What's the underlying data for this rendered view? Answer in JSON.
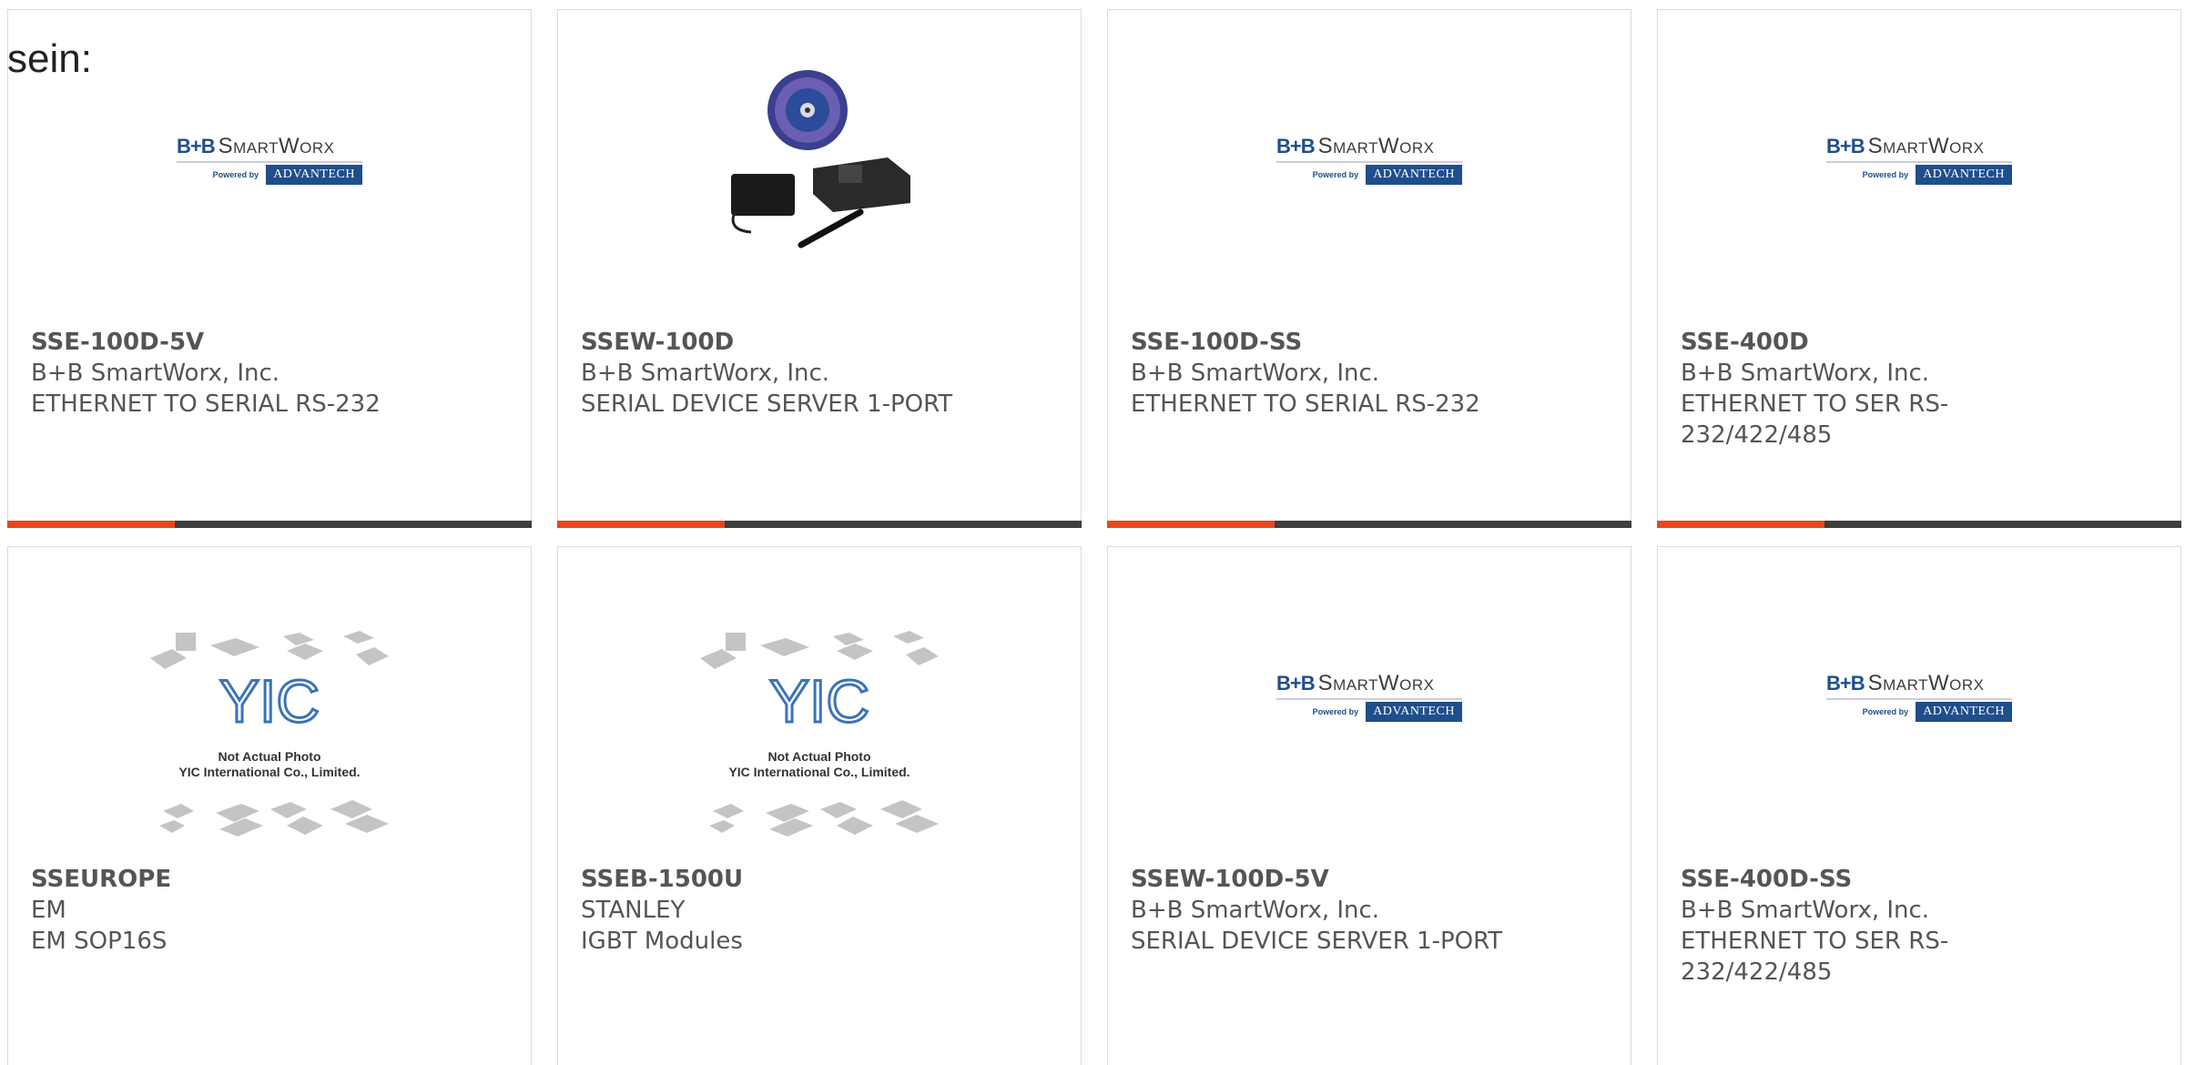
{
  "intro": {
    "text": "sein:"
  },
  "logos": {
    "bb": {
      "mark": "B+B",
      "word": "SmartWorx",
      "powered": "Powered by",
      "partner": "ADVANTECH"
    },
    "yic": {
      "line1": "Not Actual Photo",
      "line2": "YIC International Co., Limited."
    }
  },
  "products": [
    {
      "part": "SSE-100D-5V",
      "manufacturer": "B+B SmartWorx, Inc.",
      "description": "ETHERNET TO SERIAL RS-232",
      "image": "bb-logo"
    },
    {
      "part": "SSEW-100D",
      "manufacturer": "B+B SmartWorx, Inc.",
      "description": "SERIAL DEVICE SERVER 1-PORT",
      "image": "device-photo"
    },
    {
      "part": "SSE-100D-SS",
      "manufacturer": "B+B SmartWorx, Inc.",
      "description": "ETHERNET TO SERIAL RS-232",
      "image": "bb-logo"
    },
    {
      "part": "SSE-400D",
      "manufacturer": "B+B SmartWorx, Inc.",
      "description": "ETHERNET TO SER RS-232/422/485",
      "image": "bb-logo"
    },
    {
      "part": "SSEUROPE",
      "manufacturer": "EM",
      "description": "EM SOP16S",
      "image": "yic-placeholder"
    },
    {
      "part": "SSEB-1500U",
      "manufacturer": "STANLEY",
      "description": "IGBT Modules",
      "image": "yic-placeholder"
    },
    {
      "part": "SSEW-100D-5V",
      "manufacturer": "B+B SmartWorx, Inc.",
      "description": "SERIAL DEVICE SERVER 1-PORT",
      "image": "bb-logo"
    },
    {
      "part": "SSE-400D-SS",
      "manufacturer": "B+B SmartWorx, Inc.",
      "description": "ETHERNET TO SER RS-232/422/485",
      "image": "bb-logo"
    }
  ],
  "colors": {
    "accent": "#e8471b",
    "bar": "#3e3e3e",
    "text": "#555555",
    "brand_blue": "#1f4e8c"
  }
}
